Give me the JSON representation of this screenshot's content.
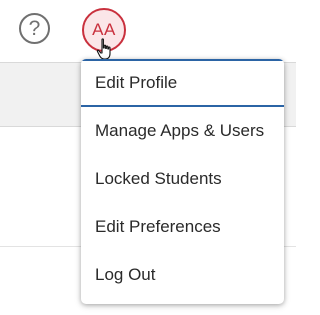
{
  "header": {
    "help_icon_glyph": "?",
    "avatar_initials": "AA",
    "avatar_color": "#c9303d"
  },
  "user_menu": {
    "items": [
      {
        "label": "Edit Profile",
        "active": true
      },
      {
        "label": "Manage Apps & Users",
        "active": false
      },
      {
        "label": "Locked Students",
        "active": false
      },
      {
        "label": "Edit Preferences",
        "active": false
      },
      {
        "label": "Log Out",
        "active": false
      }
    ],
    "active_border_color": "#2b64a5"
  }
}
